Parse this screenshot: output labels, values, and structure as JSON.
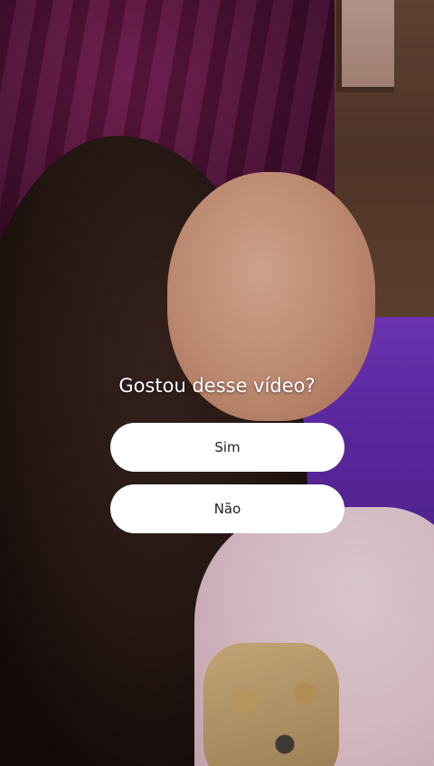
{
  "poll": {
    "question": "Gostou desse vídeo?",
    "options": [
      {
        "label": "Sim"
      },
      {
        "label": "Não"
      }
    ]
  },
  "colors": {
    "option_background": "#ffffff",
    "option_text": "#222222",
    "question_text": "#ffffff"
  }
}
